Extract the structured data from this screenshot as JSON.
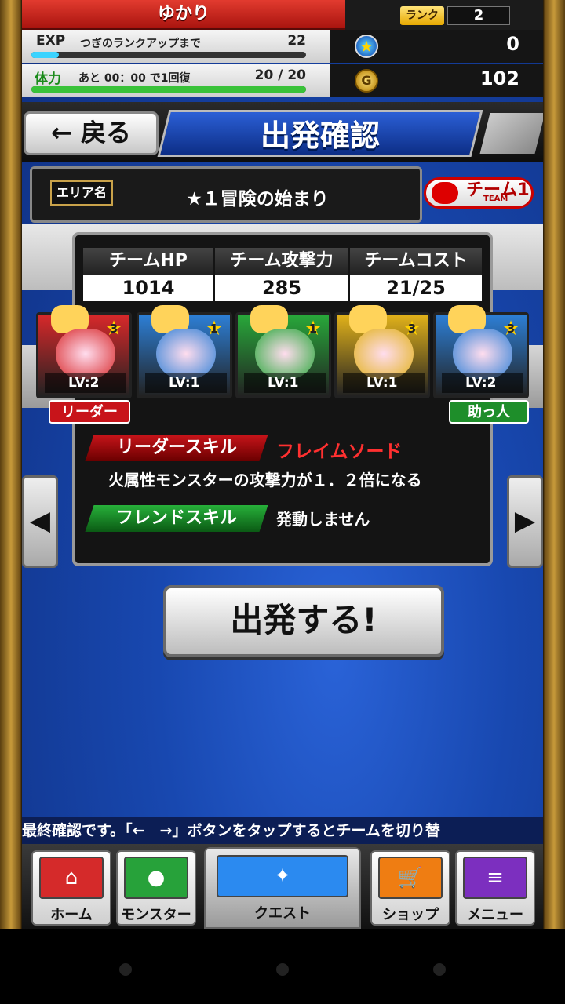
{
  "header": {
    "player_name": "ゆかり",
    "rank_label": "ランク",
    "rank_value": "2",
    "exp_label": "EXP",
    "exp_text": "つぎのランクアップまで",
    "exp_value": "22",
    "exp_progress": 0.1,
    "stamina_label": "体力",
    "stamina_text": "あと 00：00 で1回復",
    "stamina_value": "20 / 20",
    "stamina_progress": 1.0,
    "stars": "0",
    "gold": "102",
    "gold_icon_letter": "G"
  },
  "titlebar": {
    "back_label": "← 戻る",
    "title": "出発確認"
  },
  "area": {
    "badge_label": "エリア名",
    "name": "★１冒険の始まり",
    "team_label": "チーム",
    "team_sub": "TEAM",
    "team_number": "1"
  },
  "stats": {
    "hp_label": "チームHP",
    "hp_value": "1014",
    "atk_label": "チーム攻撃力",
    "atk_value": "285",
    "cost_label": "チームコスト",
    "cost_value": "21/25"
  },
  "monsters": [
    {
      "lv": "LV:2",
      "rarity": "3",
      "color": "#d8282a"
    },
    {
      "lv": "LV:1",
      "rarity": "1",
      "color": "#2d7fd6"
    },
    {
      "lv": "LV:1",
      "rarity": "1",
      "color": "#28a83a"
    },
    {
      "lv": "LV:1",
      "rarity": "3",
      "color": "#e2b21a"
    },
    {
      "lv": "LV:2",
      "rarity": "3",
      "color": "#2d7fd6"
    }
  ],
  "tags": {
    "leader": "リーダー",
    "helper": "助っ人"
  },
  "skills": {
    "leader_label": "リーダースキル",
    "leader_name": "フレイムソード",
    "leader_desc": "火属性モンスターの攻撃力が１．２倍になる",
    "friend_label": "フレンドスキル",
    "friend_desc": "発動しません"
  },
  "go_button": "出発する!",
  "ticker": "最終確認です。「←　→」ボタンをタップするとチームを切り替",
  "nav": [
    {
      "label": "ホーム",
      "color": "#d52a2a",
      "icon": "⌂"
    },
    {
      "label": "モンスター",
      "color": "#27a23a",
      "icon": "●"
    },
    {
      "label": "クエスト",
      "color": "#2b8af0",
      "icon": "✦"
    },
    {
      "label": "ショップ",
      "color": "#ef7d12",
      "icon": "🛒"
    },
    {
      "label": "メニュー",
      "color": "#7c2fbf",
      "icon": "≡"
    }
  ]
}
